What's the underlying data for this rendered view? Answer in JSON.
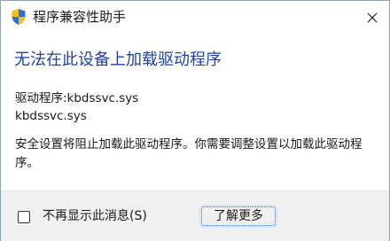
{
  "window": {
    "title": "程序兼容性助手",
    "title_icon": "shield-icon",
    "close_icon": "close-icon"
  },
  "content": {
    "heading": "无法在此设备上加载驱动程序",
    "driver_line": "驱动程序:kbdssvc.sys",
    "file_name": "kbdssvc.sys",
    "message": "安全设置将阻止加载此驱动程序。你需要调整设置以加载此驱动程序。"
  },
  "footer": {
    "checkbox_label": "不再显示此消息(S)",
    "checkbox_checked": false,
    "learn_more_label": "了解更多"
  },
  "colors": {
    "heading": "#1f3fae",
    "shield_blue": "#2f6fd6",
    "shield_yellow": "#f4c11a"
  }
}
